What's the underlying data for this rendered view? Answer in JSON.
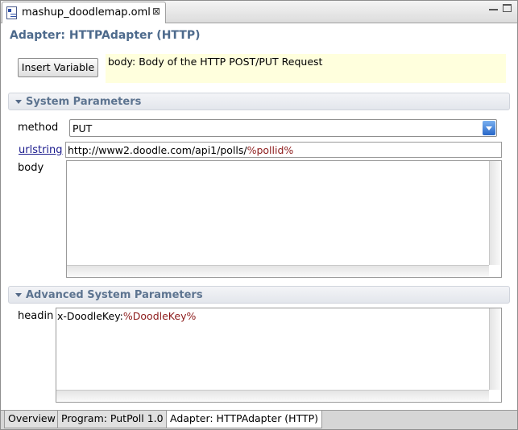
{
  "editor_tab": {
    "label": "mashup_doodlemap.oml",
    "close_glyph": "⊠"
  },
  "adapter_title": "Adapter: HTTPAdapter (HTTP)",
  "insert_variable_label": "Insert Variable",
  "hint_text": "body: Body of the HTTP POST/PUT Request",
  "system_parameters": {
    "title": "System Parameters",
    "method_label": "method",
    "method_value": "PUT",
    "urlstring_label": "urlstring",
    "urlstring_prefix": "http://www2.doodle.com/api1/polls/",
    "urlstring_var": "%pollid%",
    "body_label": "body",
    "body_value": ""
  },
  "advanced_parameters": {
    "title": "Advanced System Parameters",
    "headin_label": "headin",
    "header_key": "x-DoodleKey:",
    "header_var": "%DoodleKey%"
  },
  "bottom_tabs": [
    {
      "label": "Overview",
      "active": false
    },
    {
      "label": "Program: PutPoll 1.0",
      "active": false
    },
    {
      "label": "Adapter: HTTPAdapter (HTTP)",
      "active": true
    }
  ],
  "colors": {
    "section_title": "#5d7490",
    "variable": "#8c1a1a",
    "hint_background": "#ffffdd",
    "link": "#1a1a8c"
  },
  "icons": [
    "file-icon",
    "close-icon",
    "minimize-icon",
    "maximize-icon",
    "collapse-triangle-icon",
    "dropdown-arrow-icon"
  ]
}
